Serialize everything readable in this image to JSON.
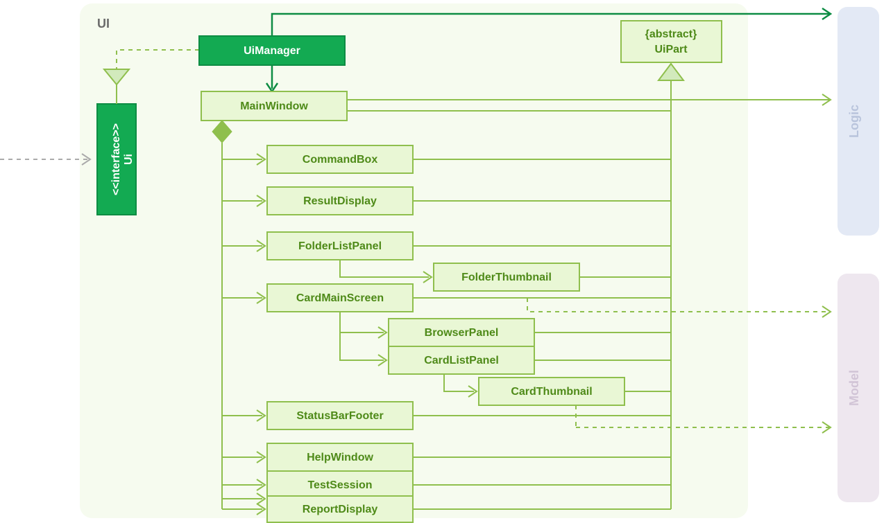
{
  "package": {
    "name": "UI"
  },
  "external": {
    "logic": "Logic",
    "model": "Model"
  },
  "interface": {
    "stereotype": "<<interface>>",
    "name": "Ui"
  },
  "classes": {
    "uiManager": "UiManager",
    "mainWindow": "MainWindow",
    "commandBox": "CommandBox",
    "resultDisplay": "ResultDisplay",
    "folderListPanel": "FolderListPanel",
    "folderThumbnail": "FolderThumbnail",
    "cardMainScreen": "CardMainScreen",
    "browserPanel": "BrowserPanel",
    "cardListPanel": "CardListPanel",
    "cardThumbnail": "CardThumbnail",
    "statusBarFooter": "StatusBarFooter",
    "helpWindow": "HelpWindow",
    "testSession": "TestSession",
    "reportDisplay": "ReportDisplay",
    "uiPartStereo": "{abstract}",
    "uiPartName": "UiPart"
  }
}
